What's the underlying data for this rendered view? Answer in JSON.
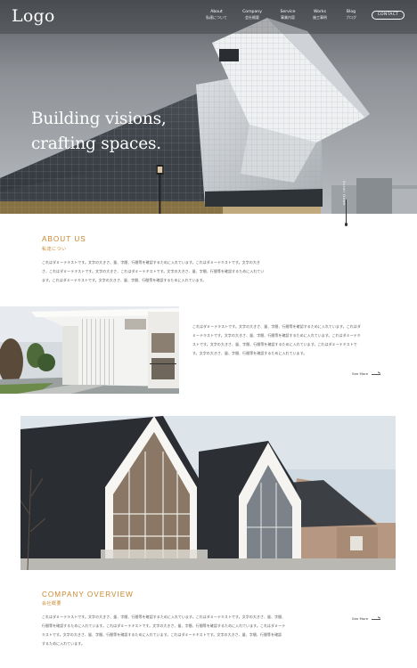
{
  "header": {
    "logo": "Logo",
    "nav": [
      {
        "en": "About",
        "jp": "私達について"
      },
      {
        "en": "Company",
        "jp": "会社概要"
      },
      {
        "en": "Service",
        "jp": "事業内容"
      },
      {
        "en": "Works",
        "jp": "施工事例"
      },
      {
        "en": "Blog",
        "jp": "ブログ"
      }
    ],
    "contact_label": "CONTACT"
  },
  "hero": {
    "title_line1": "Building visions,",
    "title_line2": "crafting spaces.",
    "scroll_label": "Scroll Down"
  },
  "about": {
    "title": "ABOUT US",
    "subtitle": "私達につい",
    "lines": [
      "これはダミーテキストです。文字の大きさ、量、字間、行間等を確認するために入れています。これはダミーテキストです。文字の大き",
      "さ、これはダミーテキストです。文字の大きさ、これはダミーテキストです。文字の大きさ、量、字間、行間等を確認するために入れてい",
      "ます。これはダミーテキストです。文字の大きさ、量、字間、行間等を確認するために入れています。"
    ]
  },
  "feature": {
    "lines": [
      "これはダミーテキストです。文字の大きさ、量、字間、行間等を確認するために入れています。これはダ",
      "ミーテキストです。文字の大きさ、量、字間、行間等を確認するために入れています。これはダミーテキ",
      "ストです。文字の大きさ、量、字間、行間等を確認するために入れています。これはダミーテキストで",
      "す。文字の大きさ、量、字間、行間等を確認するために入れています。"
    ],
    "see_more": "See More"
  },
  "company": {
    "title": "COMPANY OVERVIEW",
    "subtitle": "会社概要",
    "lines": [
      "これはダミーテキストです。文字の大きさ、量、字間、行間等を確認するために入れています。これはダミーテキストです。文字の大きさ、量、字間、",
      "行間等を確認するために入れています。これはダミーテキストです。文字の大きさ、量、字間、行間等を確認するために入れています。これはダミーテ",
      "キストです。文字の大きさ、量、字間、行間等を確認するために入れています。これはダミーテキストです。文字の大きさ、量、字間、行間等を確認",
      "するために入れています。"
    ],
    "see_more": "See More"
  }
}
